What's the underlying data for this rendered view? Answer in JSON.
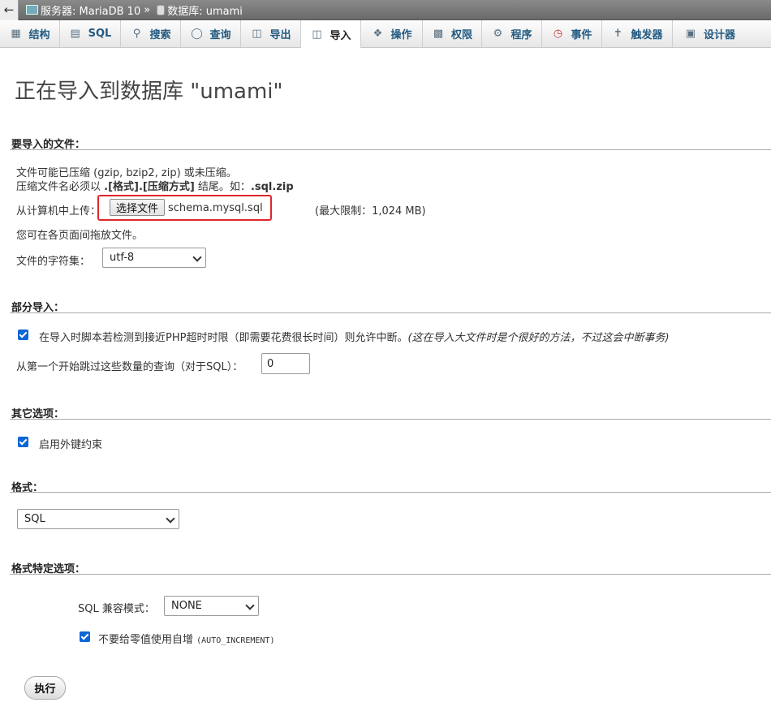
{
  "breadcrumb": {
    "server": "服务器: MariaDB 10",
    "separator": "»",
    "database": "数据库: umami"
  },
  "tabs": [
    {
      "label": "结构",
      "icon": "structure-icon"
    },
    {
      "label": "SQL",
      "icon": "sql-icon"
    },
    {
      "label": "搜索",
      "icon": "search-icon"
    },
    {
      "label": "查询",
      "icon": "query-icon"
    },
    {
      "label": "导出",
      "icon": "export-icon"
    },
    {
      "label": "导入",
      "icon": "import-icon",
      "active": true
    },
    {
      "label": "操作",
      "icon": "wrench-icon"
    },
    {
      "label": "权限",
      "icon": "privileges-icon"
    },
    {
      "label": "程序",
      "icon": "routines-icon"
    },
    {
      "label": "事件",
      "icon": "clock-icon"
    },
    {
      "label": "触发器",
      "icon": "triggers-icon"
    },
    {
      "label": "设计器",
      "icon": "designer-icon"
    }
  ],
  "page_title": "正在导入到数据库 \"umami\"",
  "file_section": {
    "legend": "要导入的文件：",
    "compress_note": "文件可能已压缩 (gzip, bzip2, zip) 或未压缩。",
    "naming_prefix": "压缩文件名必须以 ",
    "naming_format": ".[格式].[压缩方式]",
    "naming_mid": " 结尾。如：",
    "naming_example": ".sql.zip",
    "upload_label": "从计算机中上传：",
    "choose_button": "选择文件",
    "chosen_file": "schema.mysql.sql",
    "max_size": "(最大限制：1,024 MB)",
    "drag_note": "您可在各页面间拖放文件。",
    "charset_label": "文件的字符集：",
    "charset_value": "utf-8"
  },
  "partial_section": {
    "legend": "部分导入：",
    "interrupt_label": "在导入时脚本若检测到接近PHP超时时限（即需要花费很长时间）则允许中断。",
    "interrupt_note": "(这在导入大文件时是个很好的方法，不过这会中断事务)",
    "interrupt_checked": true,
    "skip_label": "从第一个开始跳过这些数量的查询（对于SQL）：",
    "skip_value": "0"
  },
  "other_section": {
    "legend": "其它选项：",
    "fk_label": "启用外键约束",
    "fk_checked": true
  },
  "format_section": {
    "legend": "格式：",
    "format_value": "SQL"
  },
  "format_options_section": {
    "legend": "格式特定选项：",
    "compat_label": "SQL 兼容模式：",
    "compat_value": "NONE",
    "auto_inc_label": "不要给零值使用自增 ",
    "auto_inc_code": "(AUTO_INCREMENT)",
    "auto_inc_checked": true
  },
  "submit_label": "执行"
}
